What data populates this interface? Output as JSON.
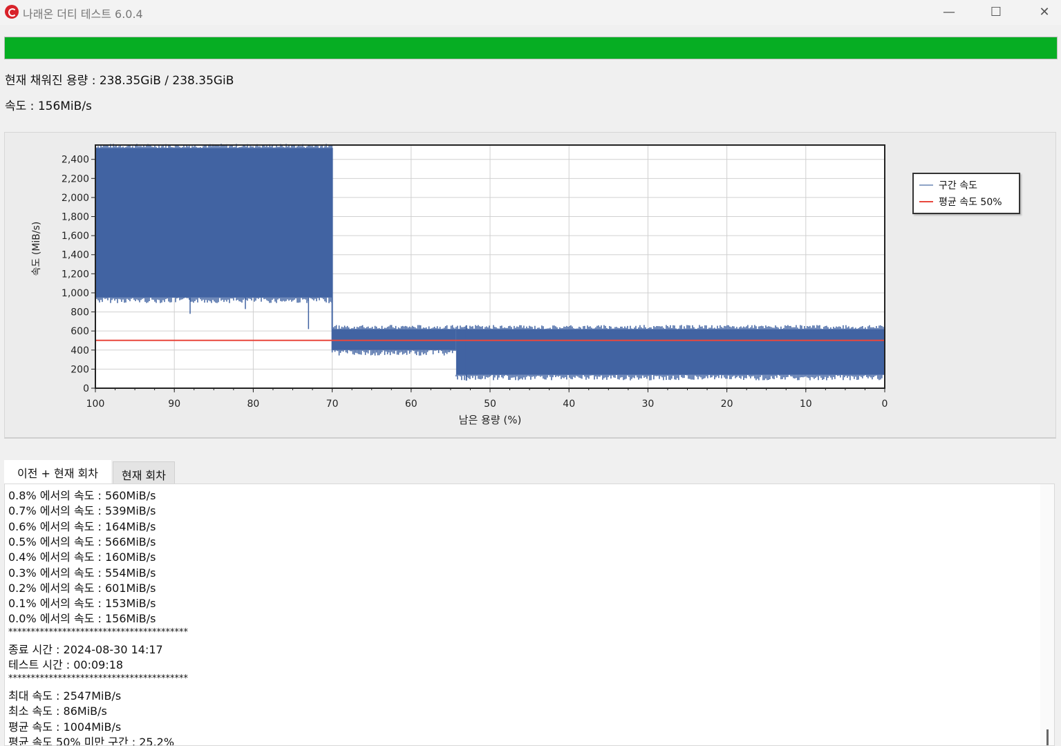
{
  "window": {
    "title": "나래온 더티 테스트 6.0.4",
    "minimize_glyph": "—",
    "maximize_glyph": "☐",
    "close_glyph": "✕"
  },
  "progress": {
    "percent": 100,
    "color": "#06ae23"
  },
  "status": {
    "filled": "현재 채워진 용량 : 238.35GiB / 238.35GiB",
    "speed": "속도 : 156MiB/s"
  },
  "chart_data": {
    "type": "area",
    "xlabel": "남은 용량 (%)",
    "ylabel": "속도 (MiB/s)",
    "xlim": [
      100,
      0
    ],
    "ylim": [
      0,
      2550
    ],
    "x_ticks": [
      100,
      90,
      80,
      70,
      60,
      50,
      40,
      30,
      20,
      10,
      0
    ],
    "y_ticks": [
      0,
      200,
      400,
      600,
      800,
      1000,
      1200,
      1400,
      1600,
      1800,
      2000,
      2200,
      2400
    ],
    "y_tick_labels": [
      "0",
      "200",
      "400",
      "600",
      "800",
      "1,000",
      "1,200",
      "1,400",
      "1,600",
      "1,800",
      "2,000",
      "2,200",
      "2,400"
    ],
    "grid": true,
    "legend_position": "right",
    "series": [
      {
        "name": "구간 속도",
        "color": "#4163a2",
        "segments": [
          {
            "x_from": 100,
            "x_to": 70,
            "min": 950,
            "max": 2520
          },
          {
            "x_from": 70,
            "x_to": 54.3,
            "min": 400,
            "max": 620
          },
          {
            "x_from": 54.3,
            "x_to": 0,
            "min": 140,
            "max": 620
          }
        ]
      },
      {
        "name": "평균 속도 50%",
        "color": "#e8473d",
        "values": [
          502,
          502
        ],
        "x": [
          100,
          0
        ]
      }
    ]
  },
  "tabs": [
    {
      "label": "이전 + 현재 회차",
      "active": true
    },
    {
      "label": "현재 회차",
      "active": false
    }
  ],
  "log_lines": [
    "0.8% 에서의 속도 : 560MiB/s",
    "0.7% 에서의 속도 : 539MiB/s",
    "0.6% 에서의 속도 : 164MiB/s",
    "0.5% 에서의 속도 : 566MiB/s",
    "0.4% 에서의 속도 : 160MiB/s",
    "0.3% 에서의 속도 : 554MiB/s",
    "0.2% 에서의 속도 : 601MiB/s",
    "0.1% 에서의 속도 : 153MiB/s",
    "0.0% 에서의 속도 : 156MiB/s",
    "****************************************",
    "종료 시간 : 2024-08-30 14:17",
    "테스트 시간 : 00:09:18",
    "****************************************",
    "최대 속도 : 2547MiB/s",
    "최소 속도 : 86MiB/s",
    "평균 속도 : 1004MiB/s",
    "평균 속도 50% 미만 구간 : 25.2%"
  ]
}
